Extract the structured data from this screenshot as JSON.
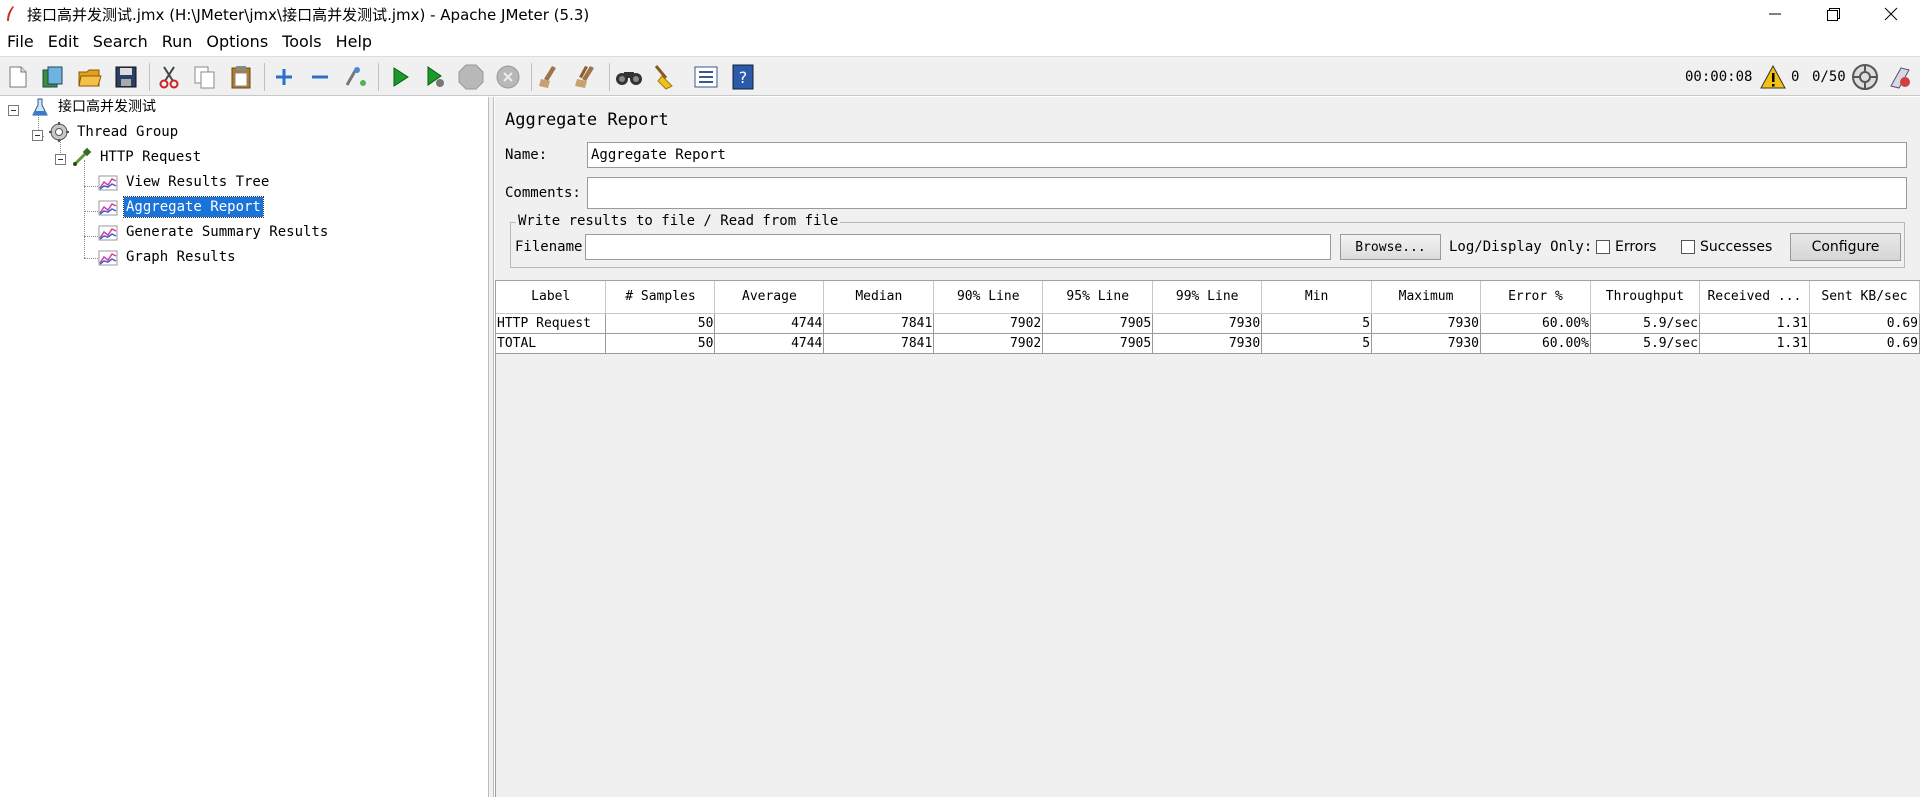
{
  "window": {
    "title": "接口高并发测试.jmx (H:\\JMeter\\jmx\\接口高并发测试.jmx) - Apache JMeter (5.3)"
  },
  "menu": [
    "File",
    "Edit",
    "Search",
    "Run",
    "Options",
    "Tools",
    "Help"
  ],
  "toolbar": {
    "icons": [
      "new-icon",
      "templates-icon",
      "open-icon",
      "save-icon",
      "cut-icon",
      "copy-icon",
      "paste-icon",
      "expand-icon",
      "collapse-icon",
      "toggle-icon",
      "start-icon",
      "start-no-pause-icon",
      "stop-icon",
      "shutdown-icon",
      "clear-icon",
      "clear-all-icon",
      "search-icon",
      "reset-search-icon",
      "function-helper-icon",
      "help-icon"
    ],
    "timer": "00:00:08",
    "warnings": "0",
    "threads": "0/50"
  },
  "tree": {
    "root": "接口高并发测试",
    "thread_group": "Thread Group",
    "sampler": "HTTP Request",
    "listeners": [
      "View Results Tree",
      "Aggregate Report",
      "Generate Summary Results",
      "Graph Results"
    ],
    "selected": "Aggregate Report"
  },
  "panel": {
    "title": "Aggregate Report",
    "name_label": "Name:",
    "name_value": "Aggregate Report",
    "comments_label": "Comments:",
    "comments_value": "",
    "file_group_title": "Write results to file / Read from file",
    "filename_label": "Filename",
    "filename_value": "",
    "browse_label": "Browse...",
    "log_display_label": "Log/Display Only:",
    "errors_label": "Errors",
    "successes_label": "Successes",
    "configure_label": "Configure"
  },
  "table": {
    "headers": [
      "Label",
      "# Samples",
      "Average",
      "Median",
      "90% Line",
      "95% Line",
      "99% Line",
      "Min",
      "Maximum",
      "Error %",
      "Throughput",
      "Received ...",
      "Sent KB/sec"
    ],
    "rows": [
      [
        "HTTP Request",
        "50",
        "4744",
        "7841",
        "7902",
        "7905",
        "7930",
        "5",
        "7930",
        "60.00%",
        "5.9/sec",
        "1.31",
        "0.69"
      ],
      [
        "TOTAL",
        "50",
        "4744",
        "7841",
        "7902",
        "7905",
        "7930",
        "5",
        "7930",
        "60.00%",
        "5.9/sec",
        "1.31",
        "0.69"
      ]
    ]
  }
}
